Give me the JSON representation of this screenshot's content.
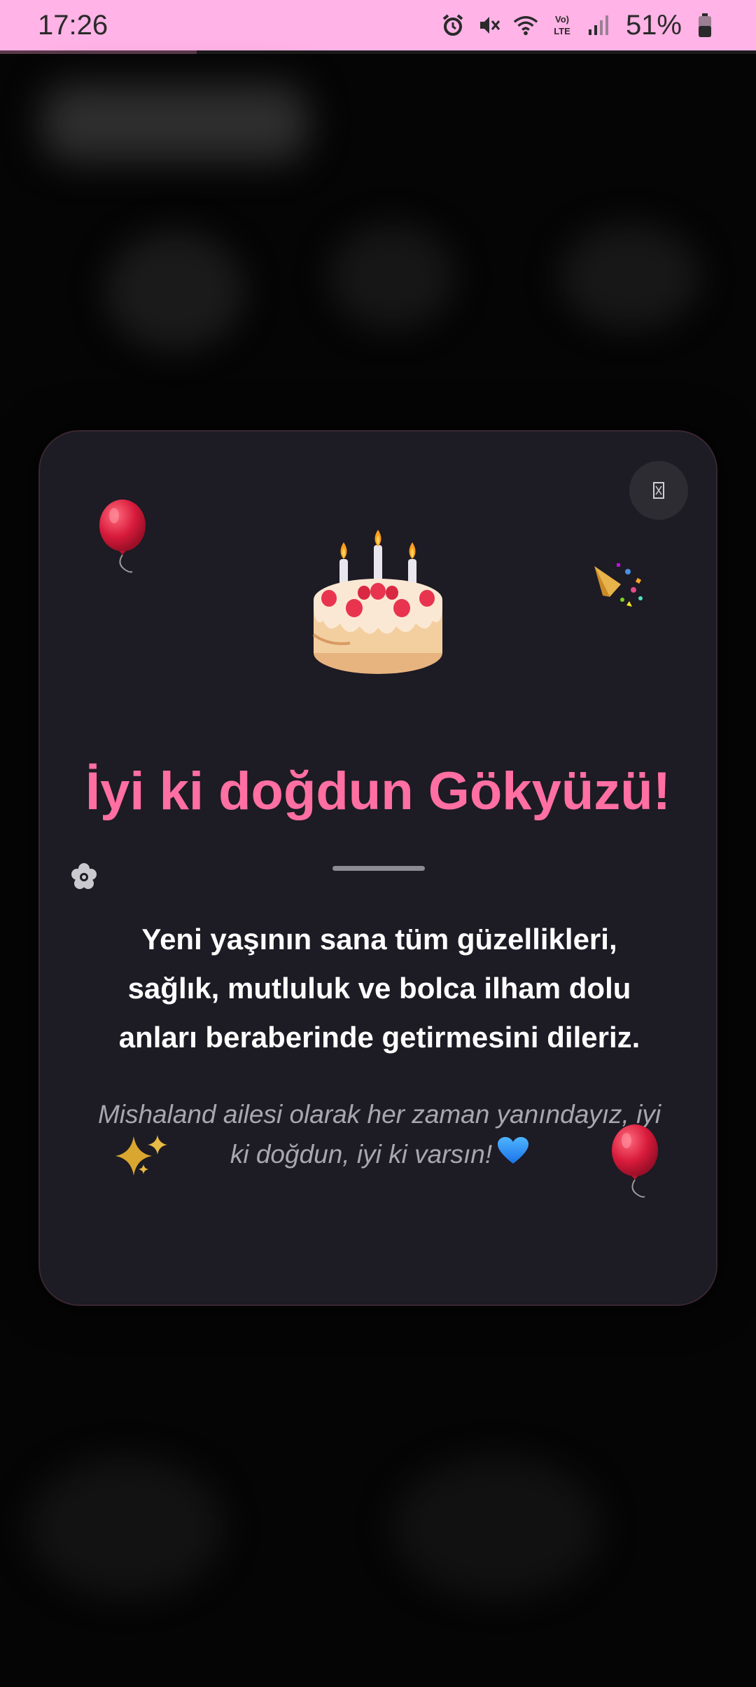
{
  "status_bar": {
    "time": "17:26",
    "battery_percent": "51%",
    "icons": [
      "alarm-icon",
      "mute-icon",
      "wifi-icon",
      "volte-icon",
      "signal-icon",
      "battery-icon"
    ],
    "background_color": "#ffb3e6"
  },
  "page_load_progress": 0.26,
  "dialog": {
    "close_icon": "close-icon",
    "title": "İyi ki doğdun Gökyüzü!",
    "message_lines": [
      "Yeni yaşının sana tüm güzellikleri,",
      "sağlık, mutluluk ve bolca ilham dolu",
      "anları beraberinde getirmesini dileriz."
    ],
    "signature_lines": [
      "Mishaland ailesi olarak her zaman yanındayız, iyi",
      "ki doğdun, iyi ki varsın!"
    ],
    "decorations": [
      "cake-icon",
      "balloon-icon",
      "party-popper-icon",
      "flower-icon",
      "sparkles-icon",
      "heart-icon"
    ],
    "title_color": "#ff6fa2",
    "background_color": "#1d1b24"
  }
}
